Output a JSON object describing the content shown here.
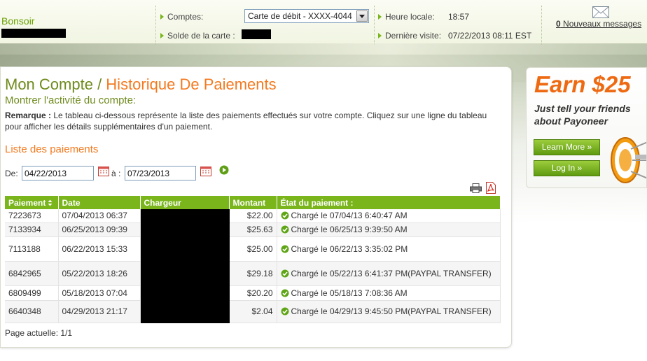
{
  "header": {
    "greeting": "Bonsoir",
    "accounts_label": "Comptes:",
    "accounts_selected": "Carte de débit - XXXX-4044",
    "balance_label": "Solde de la carte :",
    "local_time_label": "Heure locale:",
    "local_time_value": "18:57",
    "last_visit_label": "Dernière visite:",
    "last_visit_value": "07/22/2013 08:11 EST",
    "messages_count": "0",
    "messages_label": " Nouveaux messages"
  },
  "page": {
    "title_part1": "Mon Compte",
    "title_sep": " / ",
    "title_part2": "Historique De Paiements",
    "subtitle": "Montrer l'activité du compte:",
    "note_bold": "Remarque :",
    "note_text": " Le tableau ci-dessous représente la liste des paiements effectués sur votre compte. Cliquez sur une ligne du tableau pour afficher les détails supplémentaires d'un paiement.",
    "section_title": "Liste des paiements",
    "from_label": "De:",
    "from_value": "04/22/2013",
    "to_label": "à :",
    "to_value": "07/23/2013",
    "page_current": "Page actuelle: 1/1"
  },
  "table": {
    "headers": [
      "Paiement",
      "Date",
      "Chargeur",
      "Montant",
      "État du paiement :"
    ],
    "rows": [
      {
        "id": "7223673",
        "date": "07/04/2013 06:37",
        "amount": "$22.00",
        "status": "Chargé le 07/04/13 6:40:47 AM"
      },
      {
        "id": "7133934",
        "date": "06/25/2013 09:39",
        "amount": "$25.63",
        "status": "Chargé le 06/25/13 9:39:50 AM"
      },
      {
        "id": "7113188",
        "date": "06/22/2013 15:33",
        "amount": "$25.00",
        "status": "Chargé le 06/22/13 3:35:02 PM"
      },
      {
        "id": "6842965",
        "date": "05/22/2013 18:26",
        "amount": "$29.18",
        "status": "Chargé le 05/22/13 6:41:37 PM(PAYPAL TRANSFER)"
      },
      {
        "id": "6809499",
        "date": "05/18/2013 07:04",
        "amount": "$20.20",
        "status": "Chargé le 05/18/13 7:08:36 AM"
      },
      {
        "id": "6640348",
        "date": "04/29/2013 21:17",
        "amount": "$2.04",
        "status": "Chargé le 04/29/13 9:45:50 PM(PAYPAL TRANSFER)"
      }
    ]
  },
  "promo": {
    "title": "Earn $25",
    "subtitle": "Just tell your friends about Payoneer",
    "learn_more": "Learn More »",
    "login": "Log In »"
  },
  "colors": {
    "accent_green": "#79b51b",
    "accent_orange": "#f47a20",
    "title_green": "#6f8b1e"
  },
  "icons": [
    "mail-icon",
    "calendar-icon",
    "go-arrow-icon",
    "print-icon",
    "pdf-icon",
    "sort-icon",
    "check-icon",
    "megaphone-icon"
  ]
}
